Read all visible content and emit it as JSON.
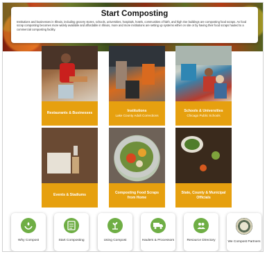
{
  "intro": {
    "title": "Start Composting",
    "body": "Institutions and businesses in Illinois, including grocery stores, schools, universities, hospitals, hotels, communities of faith, and high rise buildings are composting food scraps. As food scrap composting becomes more widely available and affordable in Illinois, more and more institutions are setting up systems either on site or by having their food scraps hauled to a commercial composting facility."
  },
  "cards": [
    {
      "title": "Restaurants & Businesses",
      "subtitle": ""
    },
    {
      "title": "Institutions",
      "subtitle": "Lake County Adult Corrections"
    },
    {
      "title": "Schools & Universities",
      "subtitle": "Chicago Public Schools"
    },
    {
      "title": "Events & Stadiums",
      "subtitle": ""
    },
    {
      "title": "Composting Food Scraps from Home",
      "subtitle": ""
    },
    {
      "title": "State, County & Municipal Officials",
      "subtitle": ""
    }
  ],
  "nav": [
    {
      "label": "Why Compost",
      "icon": "hands-sprout-icon"
    },
    {
      "label": "Start Composting",
      "icon": "checklist-icon"
    },
    {
      "label": "Using Compost",
      "icon": "plant-icon"
    },
    {
      "label": "Haulers & Processors",
      "icon": "truck-icon"
    },
    {
      "label": "Resource Directory",
      "icon": "people-icon"
    },
    {
      "label": "We Compost Partners",
      "icon": "we-compost-seal-icon"
    }
  ],
  "colors": {
    "card_accent": "#e6a00f",
    "nav_icon": "#6fae45"
  }
}
